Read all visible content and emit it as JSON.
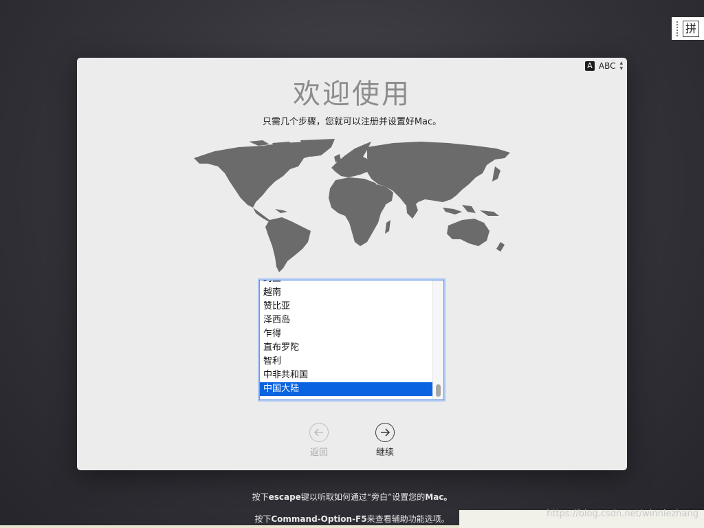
{
  "colors": {
    "selection": "#0a63e0",
    "list_focus_ring": "#6d9ae6",
    "window_bg": "#ececec",
    "desktop_bg": "#2b2a31",
    "map_land": "#6b6b6b"
  },
  "ime_indicator": {
    "glyph": "拼"
  },
  "input_source": {
    "badge": "A",
    "label": "ABC"
  },
  "welcome": {
    "title": "欢迎使用",
    "subtitle": "只需几个步骤，您就可以注册并设置好Mac。"
  },
  "country_list": {
    "items": [
      "约旦",
      "越南",
      "赞比亚",
      "泽西岛",
      "乍得",
      "直布罗陀",
      "智利",
      "中非共和国",
      "中国大陆"
    ],
    "selected": "中国大陆"
  },
  "nav": {
    "back_label": "返回",
    "continue_label": "继续"
  },
  "hints": {
    "line1_prefix": "按下",
    "line1_key": "escape",
    "line1_suffix": "键以听取如何通过“旁白”设置您的",
    "line1_mac": "Mac。",
    "line2_prefix": "按下",
    "line2_key": "Command-Option-F5",
    "line2_suffix": "来查看辅助功能选项。"
  },
  "watermark": "https://blog.csdn.net/winniezhang"
}
